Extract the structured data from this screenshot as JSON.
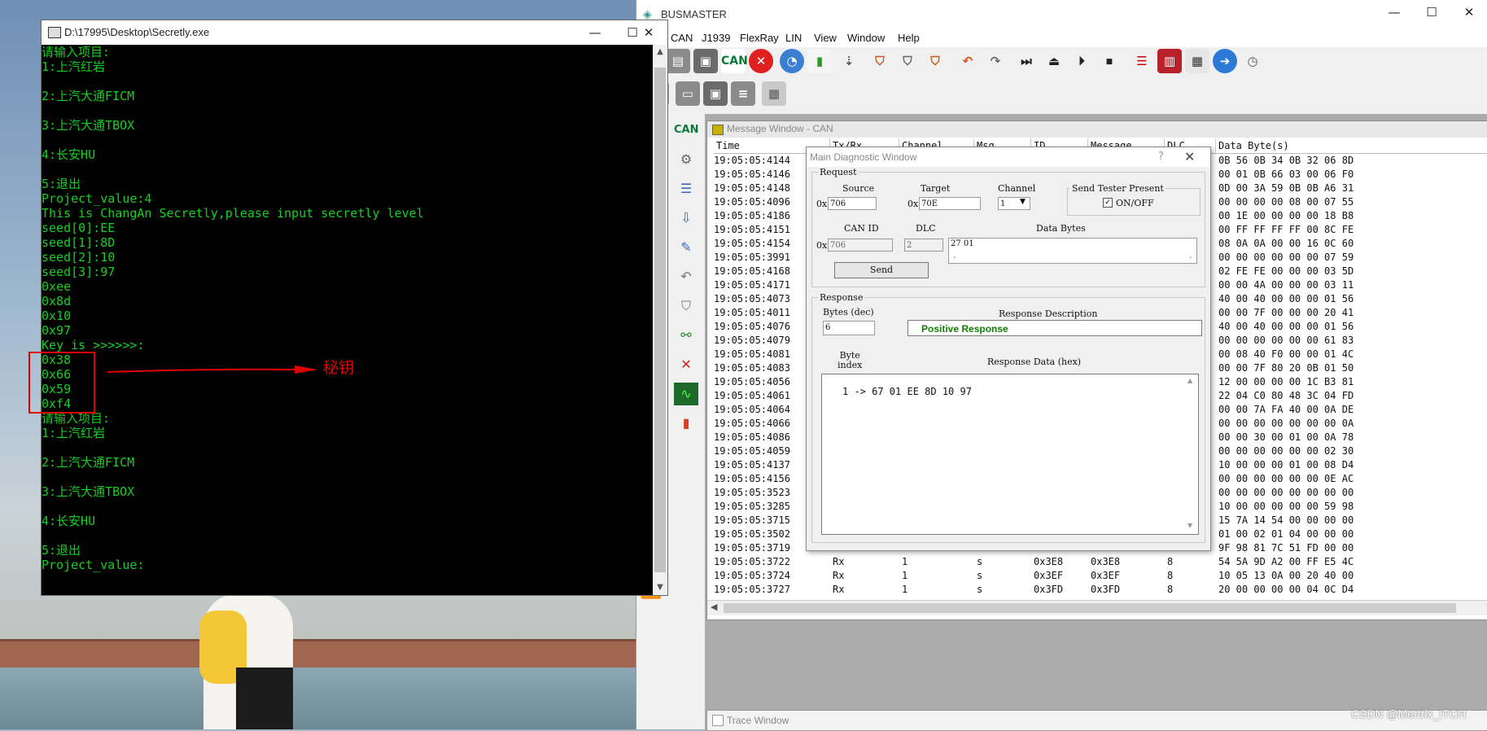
{
  "console": {
    "title": "D:\\17995\\Desktop\\Secretly.exe",
    "lines": [
      "请输入项目:",
      "1:上汽红岩",
      "",
      "2:上汽大通FICM",
      "",
      "3:上汽大通TBOX",
      "",
      "4:长安HU",
      "",
      "5:退出",
      "Project_value:4",
      "This is ChangAn Secretly,please input secretly level",
      "seed[0]:EE",
      "seed[1]:8D",
      "seed[2]:10",
      "seed[3]:97",
      "0xee",
      "0x8d",
      "0x10",
      "0x97",
      "Key is >>>>>>:",
      "0x38",
      "0x66",
      "0x59",
      "0xf4",
      "请输入项目:",
      "1:上汽红岩",
      "",
      "2:上汽大通FICM",
      "",
      "3:上汽大通TBOX",
      "",
      "4:长安HU",
      "",
      "5:退出",
      "Project_value:"
    ],
    "annotation": "秘钥"
  },
  "busmaster": {
    "title": "BUSMASTER",
    "menu": [
      "CAN",
      "J1939",
      "FlexRay",
      "LIN",
      "View",
      "Window",
      "Help"
    ],
    "toolbar_can_label": "CAN",
    "side_can_label": "CAN"
  },
  "message_window": {
    "title": "Message Window - CAN",
    "columns": [
      "Time",
      "Tx/Rx",
      "Channel",
      "Msg",
      "ID",
      "Message",
      "DLC",
      "Data Byte(s)"
    ],
    "rows": [
      {
        "time": "19:05:05:4144",
        "txrx": "",
        "ch": "",
        "msg": "",
        "id": "",
        "name": "",
        "dlc": "",
        "data": "0B 56 0B 34 0B 32 06 8D"
      },
      {
        "time": "19:05:05:4146",
        "txrx": "",
        "ch": "",
        "msg": "",
        "id": "",
        "name": "",
        "dlc": "",
        "data": "00 01 0B 66 03 00 06 F0"
      },
      {
        "time": "19:05:05:4148",
        "txrx": "",
        "ch": "",
        "msg": "",
        "id": "",
        "name": "",
        "dlc": "",
        "data": "0D 00 3A 59 0B 0B A6 31"
      },
      {
        "time": "19:05:05:4096",
        "txrx": "",
        "ch": "",
        "msg": "",
        "id": "",
        "name": "",
        "dlc": "",
        "data": "00 00 00 00 08 00 07 55"
      },
      {
        "time": "19:05:05:4186",
        "txrx": "",
        "ch": "",
        "msg": "",
        "id": "",
        "name": "",
        "dlc": "",
        "data": "00 1E 00 00 00 00 18 B8"
      },
      {
        "time": "19:05:05:4151",
        "txrx": "",
        "ch": "",
        "msg": "",
        "id": "",
        "name": "",
        "dlc": "",
        "data": "00 FF FF FF FF 00 8C FE"
      },
      {
        "time": "19:05:05:4154",
        "txrx": "",
        "ch": "",
        "msg": "",
        "id": "",
        "name": "",
        "dlc": "",
        "data": "08 0A 0A 00 00 16 0C 60"
      },
      {
        "time": "19:05:05:3991",
        "txrx": "",
        "ch": "",
        "msg": "",
        "id": "",
        "name": "",
        "dlc": "",
        "data": "00 00 00 00 00 00 07 59"
      },
      {
        "time": "19:05:05:4168",
        "txrx": "",
        "ch": "",
        "msg": "",
        "id": "",
        "name": "",
        "dlc": "",
        "data": "02 FE FE 00 00 00 03 5D"
      },
      {
        "time": "19:05:05:4171",
        "txrx": "",
        "ch": "",
        "msg": "",
        "id": "",
        "name": "",
        "dlc": "",
        "data": "00 00 4A 00 00 00 03 11"
      },
      {
        "time": "19:05:05:4073",
        "txrx": "",
        "ch": "",
        "msg": "",
        "id": "",
        "name": "",
        "dlc": "",
        "data": "40 00 40 00 00 00 01 56"
      },
      {
        "time": "19:05:05:4011",
        "txrx": "",
        "ch": "",
        "msg": "",
        "id": "",
        "name": "",
        "dlc": "",
        "data": "00 00 7F 00 00 00 20 41"
      },
      {
        "time": "19:05:05:4076",
        "txrx": "",
        "ch": "",
        "msg": "",
        "id": "",
        "name": "",
        "dlc": "",
        "data": "40 00 40 00 00 00 01 56"
      },
      {
        "time": "19:05:05:4079",
        "txrx": "",
        "ch": "",
        "msg": "",
        "id": "",
        "name": "",
        "dlc": "",
        "data": "00 00 00 00 00 00 61 83"
      },
      {
        "time": "19:05:05:4081",
        "txrx": "",
        "ch": "",
        "msg": "",
        "id": "",
        "name": "",
        "dlc": "",
        "data": "00 08 40 F0 00 00 01 4C"
      },
      {
        "time": "19:05:05:4083",
        "txrx": "",
        "ch": "",
        "msg": "",
        "id": "",
        "name": "",
        "dlc": "",
        "data": "00 00 7F 80 20 0B 01 50"
      },
      {
        "time": "19:05:05:4056",
        "txrx": "",
        "ch": "",
        "msg": "",
        "id": "",
        "name": "",
        "dlc": "",
        "data": "12 00 00 00 00 1C B3 81"
      },
      {
        "time": "19:05:05:4061",
        "txrx": "",
        "ch": "",
        "msg": "",
        "id": "",
        "name": "",
        "dlc": "",
        "data": "22 04 C0 80 48 3C 04 FD"
      },
      {
        "time": "19:05:05:4064",
        "txrx": "",
        "ch": "",
        "msg": "",
        "id": "",
        "name": "",
        "dlc": "",
        "data": "00 00 7A FA 40 00 0A DE"
      },
      {
        "time": "19:05:05:4066",
        "txrx": "",
        "ch": "",
        "msg": "",
        "id": "",
        "name": "",
        "dlc": "",
        "data": "00 00 00 00 00 00 00 0A"
      },
      {
        "time": "19:05:05:4086",
        "txrx": "",
        "ch": "",
        "msg": "",
        "id": "",
        "name": "",
        "dlc": "",
        "data": "00 00 30 00 01 00 0A 78"
      },
      {
        "time": "19:05:05:4059",
        "txrx": "",
        "ch": "",
        "msg": "",
        "id": "",
        "name": "",
        "dlc": "",
        "data": "00 00 00 00 00 00 02 30"
      },
      {
        "time": "19:05:05:4137",
        "txrx": "",
        "ch": "",
        "msg": "",
        "id": "",
        "name": "",
        "dlc": "",
        "data": "10 00 00 00 01 00 08 D4"
      },
      {
        "time": "19:05:05:4156",
        "txrx": "",
        "ch": "",
        "msg": "",
        "id": "",
        "name": "",
        "dlc": "",
        "data": "00 00 00 00 00 00 0E AC"
      },
      {
        "time": "19:05:05:3523",
        "txrx": "",
        "ch": "",
        "msg": "",
        "id": "",
        "name": "",
        "dlc": "",
        "data": "00 00 00 00 00 00 00 00"
      },
      {
        "time": "19:05:05:3285",
        "txrx": "",
        "ch": "",
        "msg": "",
        "id": "",
        "name": "",
        "dlc": "",
        "data": "10 00 00 00 00 00 59 98"
      },
      {
        "time": "19:05:05:3715",
        "txrx": "",
        "ch": "",
        "msg": "",
        "id": "",
        "name": "",
        "dlc": "",
        "data": "15 7A 14 54 00 00 00 00"
      },
      {
        "time": "19:05:05:3502",
        "txrx": "",
        "ch": "",
        "msg": "",
        "id": "",
        "name": "",
        "dlc": "",
        "data": "01 00 02 01 04 00 00 00"
      },
      {
        "time": "19:05:05:3719",
        "txrx": "",
        "ch": "",
        "msg": "",
        "id": "",
        "name": "",
        "dlc": "",
        "data": "9F 98 81 7C 51 FD 00 00"
      },
      {
        "time": "19:05:05:3722",
        "txrx": "Rx",
        "ch": "1",
        "msg": "s",
        "id": "0x3E8",
        "name": "0x3E8",
        "dlc": "8",
        "data": "54 5A 9D A2 00 FF E5 4C"
      },
      {
        "time": "19:05:05:3724",
        "txrx": "Rx",
        "ch": "1",
        "msg": "s",
        "id": "0x3EF",
        "name": "0x3EF",
        "dlc": "8",
        "data": "10 05 13 0A 00 20 40 00"
      },
      {
        "time": "19:05:05:3727",
        "txrx": "Rx",
        "ch": "1",
        "msg": "s",
        "id": "0x3FD",
        "name": "0x3FD",
        "dlc": "8",
        "data": "20 00 00 00 00 04 0C D4"
      }
    ]
  },
  "trace_window": {
    "title": "Trace Window"
  },
  "dialog": {
    "title": "Main Diagnostic Window",
    "help": "?",
    "close": "✕",
    "request_label": "Request",
    "source_label": "Source",
    "target_label": "Target",
    "channel_label": "Channel",
    "ox": "0x",
    "source_value": "706",
    "target_value": "70E",
    "channel_value": "1",
    "tester_group": "Send Tester Present",
    "tester_checkbox": "ON/OFF",
    "canid_label": "CAN ID",
    "dlc_label": "DLC",
    "databytes_label": "Data Bytes",
    "canid_value": "706",
    "dlc_value": "2",
    "databytes_value": "27 01",
    "send_label": "Send",
    "response_label": "Response",
    "bytes_label": "Bytes (dec)",
    "bytes_value": "6",
    "desc_label": "Response Description",
    "desc_value": "Positive Response",
    "byteindex_label": "Byte\nindex",
    "respdata_label": "Response Data (hex)",
    "respdata_value": "1 -> 67 01 EE 8D 10 97"
  },
  "watermark": "CSDN @Mertrix_ITCH",
  "colors": {
    "console_text": "#14d11f",
    "annotation": "#e00000",
    "positive": "#108000"
  }
}
